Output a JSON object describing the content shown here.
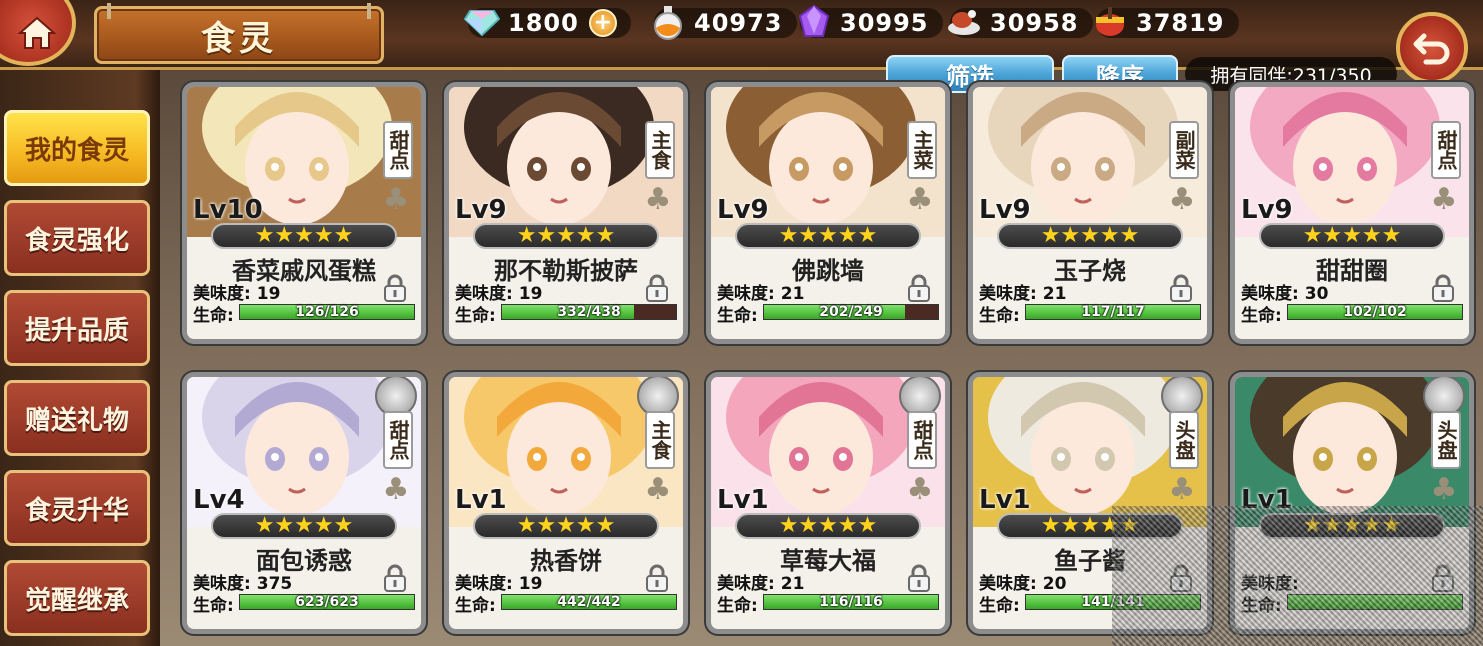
{
  "header": {
    "title": "食灵",
    "resources": [
      {
        "icon": "rainbow-diamond-icon",
        "value": "1800",
        "has_plus": true
      },
      {
        "icon": "potion-flask-icon",
        "value": "40973"
      },
      {
        "icon": "purple-crystal-icon",
        "value": "30995"
      },
      {
        "icon": "meat-dish-icon",
        "value": "30958"
      },
      {
        "icon": "spice-pot-icon",
        "value": "37819"
      }
    ],
    "plus_label": "+"
  },
  "filters": {
    "filter_label": "筛选",
    "sort_label": "降序",
    "owned_label": "拥有同伴:231/350"
  },
  "sidebar": {
    "items": [
      {
        "label": "我的食灵",
        "active": true
      },
      {
        "label": "食灵强化"
      },
      {
        "label": "提升品质"
      },
      {
        "label": "赠送礼物"
      },
      {
        "label": "食灵升华"
      },
      {
        "label": "觉醒继承"
      }
    ]
  },
  "labels": {
    "taste": "美味度:",
    "hp": "生命:",
    "stars": "★★★★★"
  },
  "cards": [
    {
      "level": "Lv10",
      "name": "香菜戚风蛋糕",
      "category": "甜点",
      "taste": "19",
      "hp": "126/126",
      "hp_pct": 1.0,
      "palette": [
        "#f3e6b8",
        "#e6c98a",
        "#a77b4a"
      ]
    },
    {
      "level": "Lv9",
      "name": "那不勒斯披萨",
      "category": "主食",
      "taste": "19",
      "hp": "332/438",
      "hp_pct": 0.758,
      "palette": [
        "#3a2a22",
        "#6b4a34",
        "#f2d9c4"
      ]
    },
    {
      "level": "Lv9",
      "name": "佛跳墙",
      "category": "主菜",
      "taste": "21",
      "hp": "202/249",
      "hp_pct": 0.811,
      "palette": [
        "#8b5e34",
        "#c79a64",
        "#f4e3cc"
      ]
    },
    {
      "level": "Lv9",
      "name": "玉子烧",
      "category": "副菜",
      "taste": "21",
      "hp": "117/117",
      "hp_pct": 1.0,
      "palette": [
        "#e8d6bc",
        "#c9aa84",
        "#f7ecdc"
      ]
    },
    {
      "level": "Lv9",
      "name": "甜甜圈",
      "category": "甜点",
      "taste": "30",
      "hp": "102/102",
      "hp_pct": 1.0,
      "palette": [
        "#f2a9c1",
        "#e57aa0",
        "#fbe3ec"
      ]
    },
    {
      "level": "Lv4",
      "name": "面包诱惑",
      "category": "甜点",
      "taste": "375",
      "hp": "623/623",
      "hp_pct": 1.0,
      "palette": [
        "#d9d4ea",
        "#b3aad4",
        "#f5f1fb"
      ]
    },
    {
      "level": "Lv1",
      "name": "热香饼",
      "category": "主食",
      "taste": "19",
      "hp": "442/442",
      "hp_pct": 1.0,
      "palette": [
        "#f6c86a",
        "#f2a83a",
        "#fbe6c4"
      ]
    },
    {
      "level": "Lv1",
      "name": "草莓大福",
      "category": "甜点",
      "taste": "21",
      "hp": "116/116",
      "hp_pct": 1.0,
      "palette": [
        "#f4a6bd",
        "#e27495",
        "#fbe2ea"
      ]
    },
    {
      "level": "Lv1",
      "name": "鱼子酱",
      "category": "头盘",
      "taste": "20",
      "hp": "141/141",
      "hp_pct": 1.0,
      "palette": [
        "#eeeae0",
        "#d2c8b0",
        "#e6c14a"
      ]
    },
    {
      "level": "Lv1",
      "name": "",
      "category": "头盘",
      "taste": "",
      "hp": "",
      "hp_pct": 1.0,
      "palette": [
        "#4a3a2a",
        "#c9a54a",
        "#3a8a6a"
      ]
    }
  ],
  "colors": {
    "accent_gold": "#e3b45a",
    "active_tab": "#f6b922",
    "hp_green": "#39a825",
    "filter_blue": "#4aa3d6"
  }
}
